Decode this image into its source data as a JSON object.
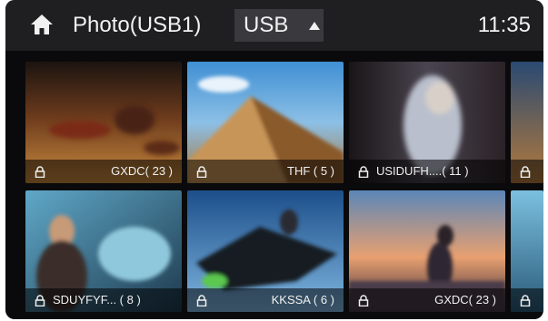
{
  "header": {
    "title": "Photo(USB1)",
    "source_label": "USB",
    "time": "11:35"
  },
  "colors": {
    "topbar": "#1f1f22",
    "background": "#0a0a0c",
    "source_button": "#3a3a3e",
    "text": "#f2f2f2"
  },
  "icons": {
    "home": "home-icon",
    "lock": "lock-icon",
    "source_caret": "caret-up-icon"
  },
  "folders": [
    {
      "label": "GXDC( 23 )"
    },
    {
      "label": "THF ( 5 )"
    },
    {
      "label": "USIDUFH....( 11 )"
    },
    {
      "label": ""
    },
    {
      "label": "SDUYFYF... ( 8 )"
    },
    {
      "label": "KKSSA ( 6 )"
    },
    {
      "label": "GXDC( 23 )"
    },
    {
      "label": ""
    }
  ]
}
